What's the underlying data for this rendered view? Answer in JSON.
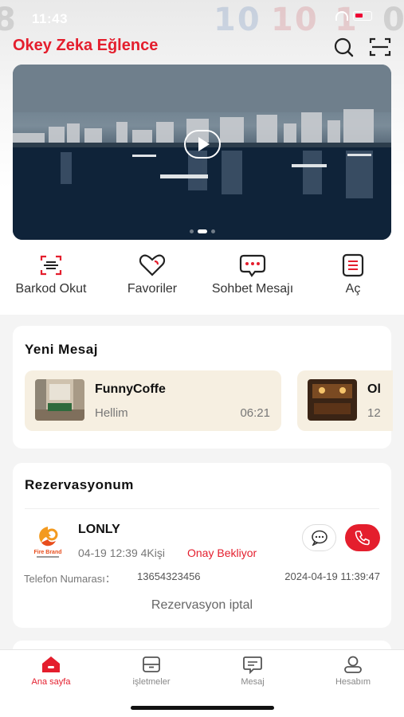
{
  "status_bar": {
    "time": "11:43"
  },
  "header": {
    "title": "Okey Zeka Eğlence"
  },
  "banner": {
    "dots": 3,
    "active_dot": 2
  },
  "quick_actions": [
    {
      "label": "Barkod Okut",
      "icon": "barcode-scan-icon"
    },
    {
      "label": "Favoriler",
      "icon": "heart-icon"
    },
    {
      "label": "Sohbet Mesajı",
      "icon": "chat-bubble-icon"
    },
    {
      "label": "Aç",
      "icon": "document-icon"
    }
  ],
  "new_messages": {
    "title": "Yeni Mesaj",
    "items": [
      {
        "name": "FunnyCoffe",
        "text": "Hellim",
        "time": "06:21"
      },
      {
        "name": "Ol",
        "text": "",
        "time": "12"
      }
    ]
  },
  "reservation": {
    "title": "Rezervasyonum",
    "venue_name": "LONLY",
    "date_people": "04-19 12:39 4Kişi",
    "status": "Onay Bekliyor",
    "phone_label": "Telefon Numarası：",
    "phone_value": "13654323456",
    "created_at": "2024-04-19 11:39:47",
    "cancel_label": "Rezervasyon iptal",
    "logo_text": "Fire Brand"
  },
  "tabbar": [
    {
      "label": "Ana sayfa",
      "icon": "home-icon",
      "active": true
    },
    {
      "label": "işletmeler",
      "icon": "store-icon",
      "active": false
    },
    {
      "label": "Mesaj",
      "icon": "message-icon",
      "active": false
    },
    {
      "label": "Hesabım",
      "icon": "user-icon",
      "active": false
    }
  ],
  "colors": {
    "accent": "#e41e2d",
    "message_card_bg": "#f6efe1",
    "page_bg": "#f4f4f4"
  }
}
